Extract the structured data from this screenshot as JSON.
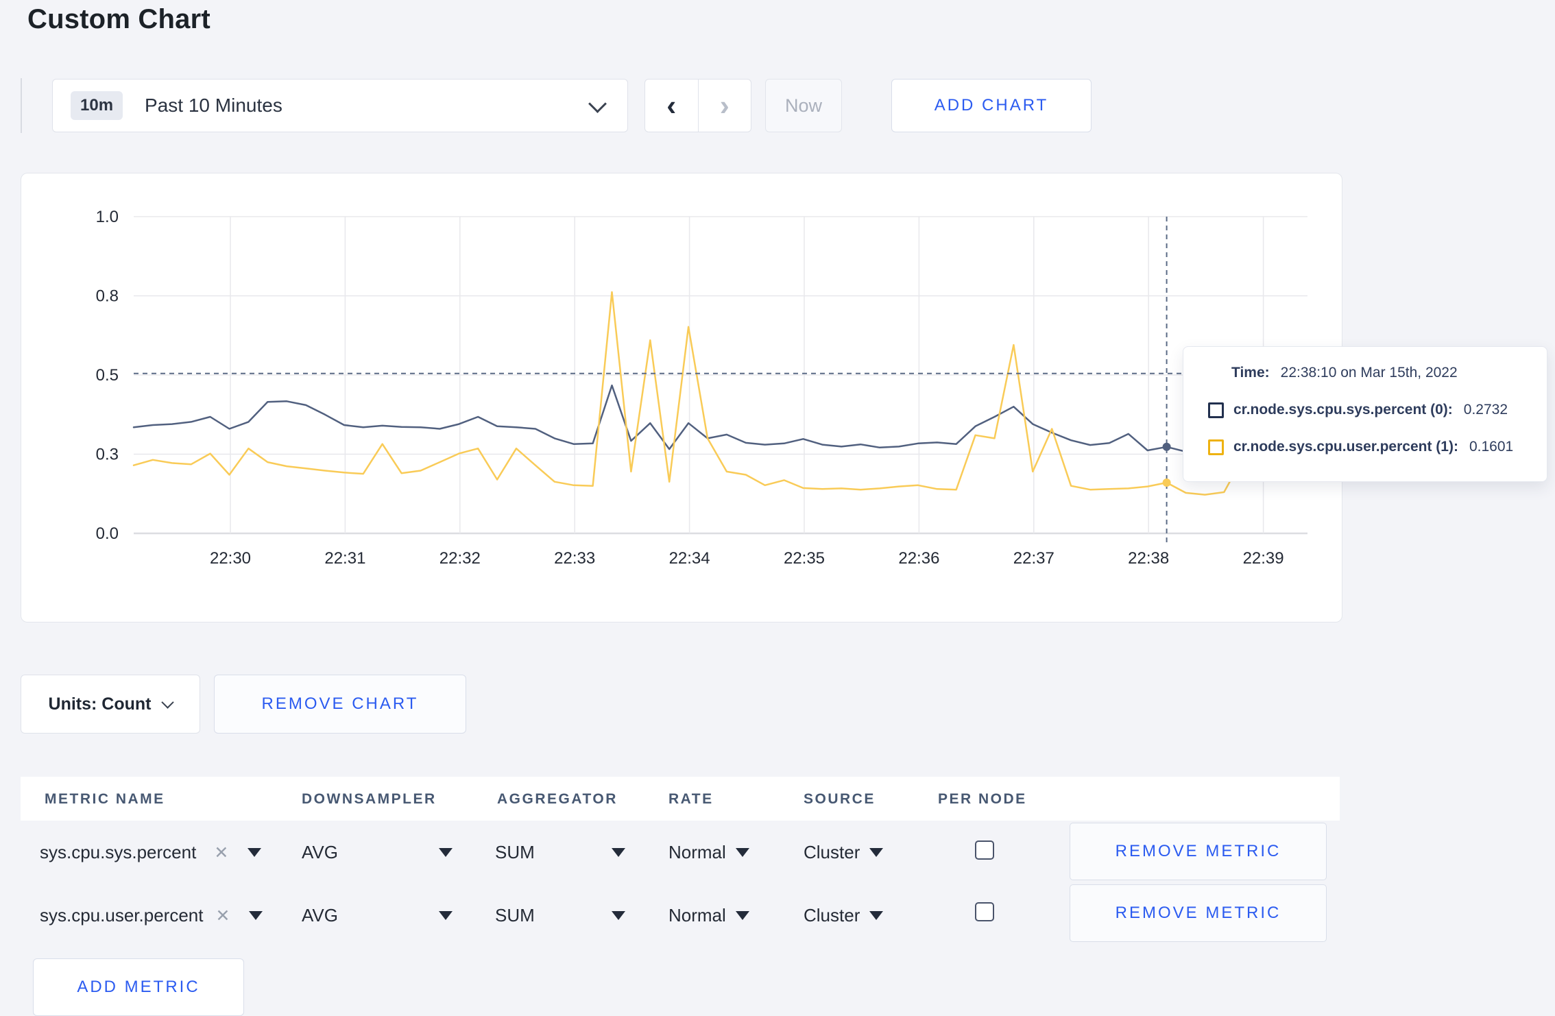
{
  "page": {
    "title": "Custom Chart",
    "background": "#f3f4f8",
    "accent_blue": "#2b5bf0",
    "text_dark": "#242a35"
  },
  "toolbar": {
    "range_badge": "10m",
    "range_label": "Past 10 Minutes",
    "prev_icon": "‹",
    "next_icon": "›",
    "now_label": "Now",
    "add_chart_label": "ADD CHART"
  },
  "chart_controls": {
    "units_label": "Units: Count",
    "remove_chart_label": "REMOVE CHART"
  },
  "tooltip": {
    "time_label": "Time:",
    "time_value": "22:38:10 on Mar 15th, 2022",
    "series": [
      {
        "label": "cr.node.sys.cpu.sys.percent (0):",
        "value": "0.2732",
        "color": "#22304e"
      },
      {
        "label": "cr.node.sys.cpu.user.percent (1):",
        "value": "0.1601",
        "color": "#eeb211"
      }
    ]
  },
  "chart_data": {
    "type": "line",
    "title": "",
    "xlabel": "",
    "ylabel": "",
    "x_start": "22:29:10",
    "x_interval_seconds": 10,
    "x_tick_labels": [
      "22:30",
      "22:31",
      "22:32",
      "22:33",
      "22:34",
      "22:35",
      "22:36",
      "22:37",
      "22:38",
      "22:39"
    ],
    "y_tick_values": [
      0,
      0.25,
      0.5,
      0.75,
      1.0
    ],
    "y_tick_labels": [
      "0.0",
      "0.3",
      "0.5",
      "0.8",
      "1.0"
    ],
    "ylim": [
      0,
      1.0
    ],
    "grid": true,
    "legend_position": "tooltip",
    "crosshair": {
      "time_index": 54,
      "time_label": "22:38:10",
      "guide_value": 0.505
    },
    "series": [
      {
        "name": "cr.node.sys.cpu.sys.percent (0)",
        "color": "#51607f",
        "hover_value": 0.2732,
        "values": [
          0.335,
          0.342,
          0.345,
          0.352,
          0.368,
          0.33,
          0.352,
          0.415,
          0.417,
          0.405,
          0.375,
          0.342,
          0.335,
          0.34,
          0.336,
          0.335,
          0.33,
          0.345,
          0.368,
          0.338,
          0.335,
          0.33,
          0.3,
          0.282,
          0.284,
          0.467,
          0.292,
          0.348,
          0.266,
          0.348,
          0.3,
          0.312,
          0.286,
          0.28,
          0.284,
          0.298,
          0.28,
          0.274,
          0.281,
          0.271,
          0.274,
          0.284,
          0.287,
          0.282,
          0.338,
          0.368,
          0.4,
          0.345,
          0.318,
          0.294,
          0.279,
          0.285,
          0.314,
          0.262,
          0.2732,
          0.258,
          0.262,
          0.258,
          0.26,
          0.258,
          0.262,
          0.265
        ]
      },
      {
        "name": "cr.node.sys.cpu.user.percent (1)",
        "color": "#f9cb57",
        "hover_value": 0.1601,
        "values": [
          0.215,
          0.232,
          0.222,
          0.218,
          0.252,
          0.185,
          0.268,
          0.225,
          0.212,
          0.205,
          0.198,
          0.192,
          0.188,
          0.282,
          0.19,
          0.198,
          0.225,
          0.252,
          0.268,
          0.17,
          0.268,
          0.215,
          0.163,
          0.152,
          0.15,
          0.762,
          0.195,
          0.61,
          0.163,
          0.652,
          0.3,
          0.195,
          0.185,
          0.152,
          0.168,
          0.143,
          0.14,
          0.142,
          0.138,
          0.142,
          0.148,
          0.152,
          0.14,
          0.138,
          0.31,
          0.3,
          0.595,
          0.195,
          0.33,
          0.15,
          0.138,
          0.14,
          0.142,
          0.148,
          0.1601,
          0.128,
          0.122,
          0.13,
          0.24,
          0.272,
          0.195,
          0.245
        ]
      }
    ]
  },
  "metrics_table": {
    "headers": [
      "METRIC NAME",
      "DOWNSAMPLER",
      "AGGREGATOR",
      "RATE",
      "SOURCE",
      "PER NODE"
    ],
    "remove_metric_label": "REMOVE METRIC",
    "add_metric_label": "ADD METRIC",
    "rows": [
      {
        "name": "sys.cpu.sys.percent",
        "downsampler": "AVG",
        "aggregator": "SUM",
        "rate": "Normal",
        "source": "Cluster",
        "per_node_checked": false
      },
      {
        "name": "sys.cpu.user.percent",
        "downsampler": "AVG",
        "aggregator": "SUM",
        "rate": "Normal",
        "source": "Cluster",
        "per_node_checked": false
      }
    ]
  }
}
